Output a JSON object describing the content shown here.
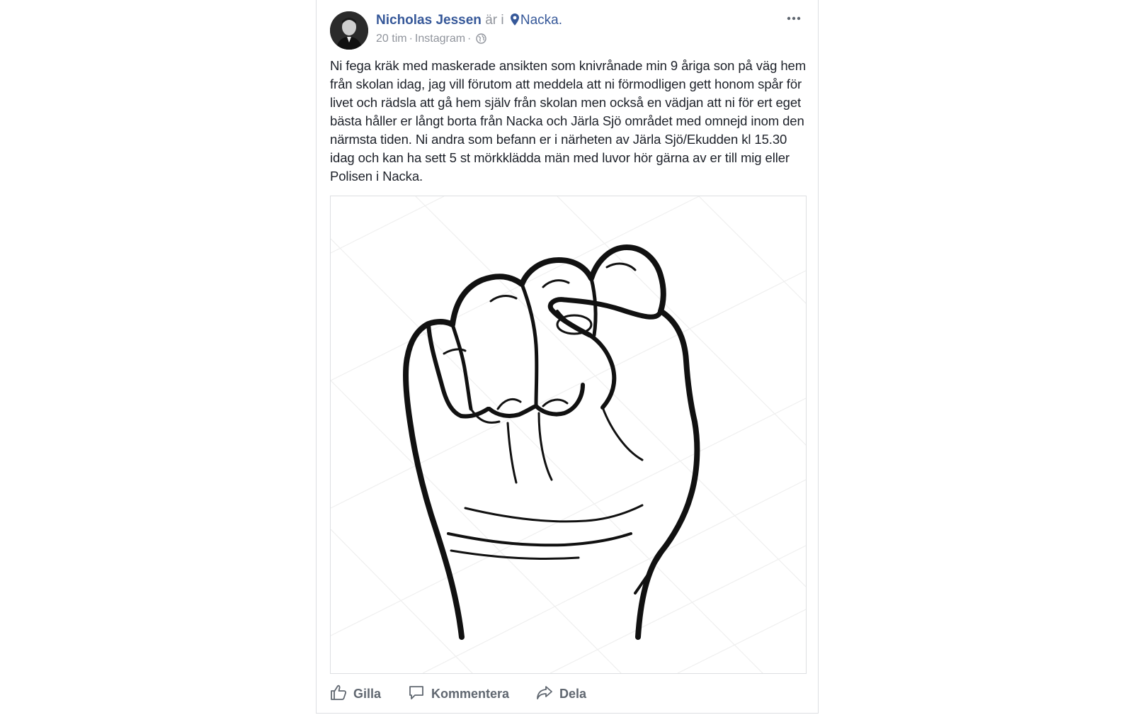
{
  "post": {
    "author": "Nicholas Jessen",
    "location_prefix": "är i",
    "location": "Nacka.",
    "time": "20 tim",
    "source": "Instagram",
    "meta_separator": "·",
    "text": "Ni fega kräk med maskerade ansikten som knivrånade min 9 åriga son på väg hem från skolan idag, jag vill förutom att meddela att ni förmodligen gett honom spår för livet och rädsla att gå hem själv från skolan men också en vädjan att ni för ert eget bästa håller er långt borta från Nacka och Järla Sjö området med omnejd inom den närmsta tiden. Ni andra som befann er i närheten av Järla Sjö/Ekudden kl 15.30 idag och kan ha sett 5 st mörkklädda män med luvor hör gärna av er till mig eller Polisen i Nacka."
  },
  "actions": {
    "like": "Gilla",
    "comment": "Kommentera",
    "share": "Dela"
  },
  "icons": {
    "more": "more-dots-icon",
    "location": "map-pin-icon",
    "privacy": "globe-icon",
    "like": "thumbs-up-icon",
    "comment": "speech-bubble-icon",
    "share": "share-arrow-icon"
  },
  "colors": {
    "link": "#365899",
    "meta": "#90949c",
    "text": "#1d2129",
    "action": "#606770",
    "border": "#dddfe2"
  }
}
